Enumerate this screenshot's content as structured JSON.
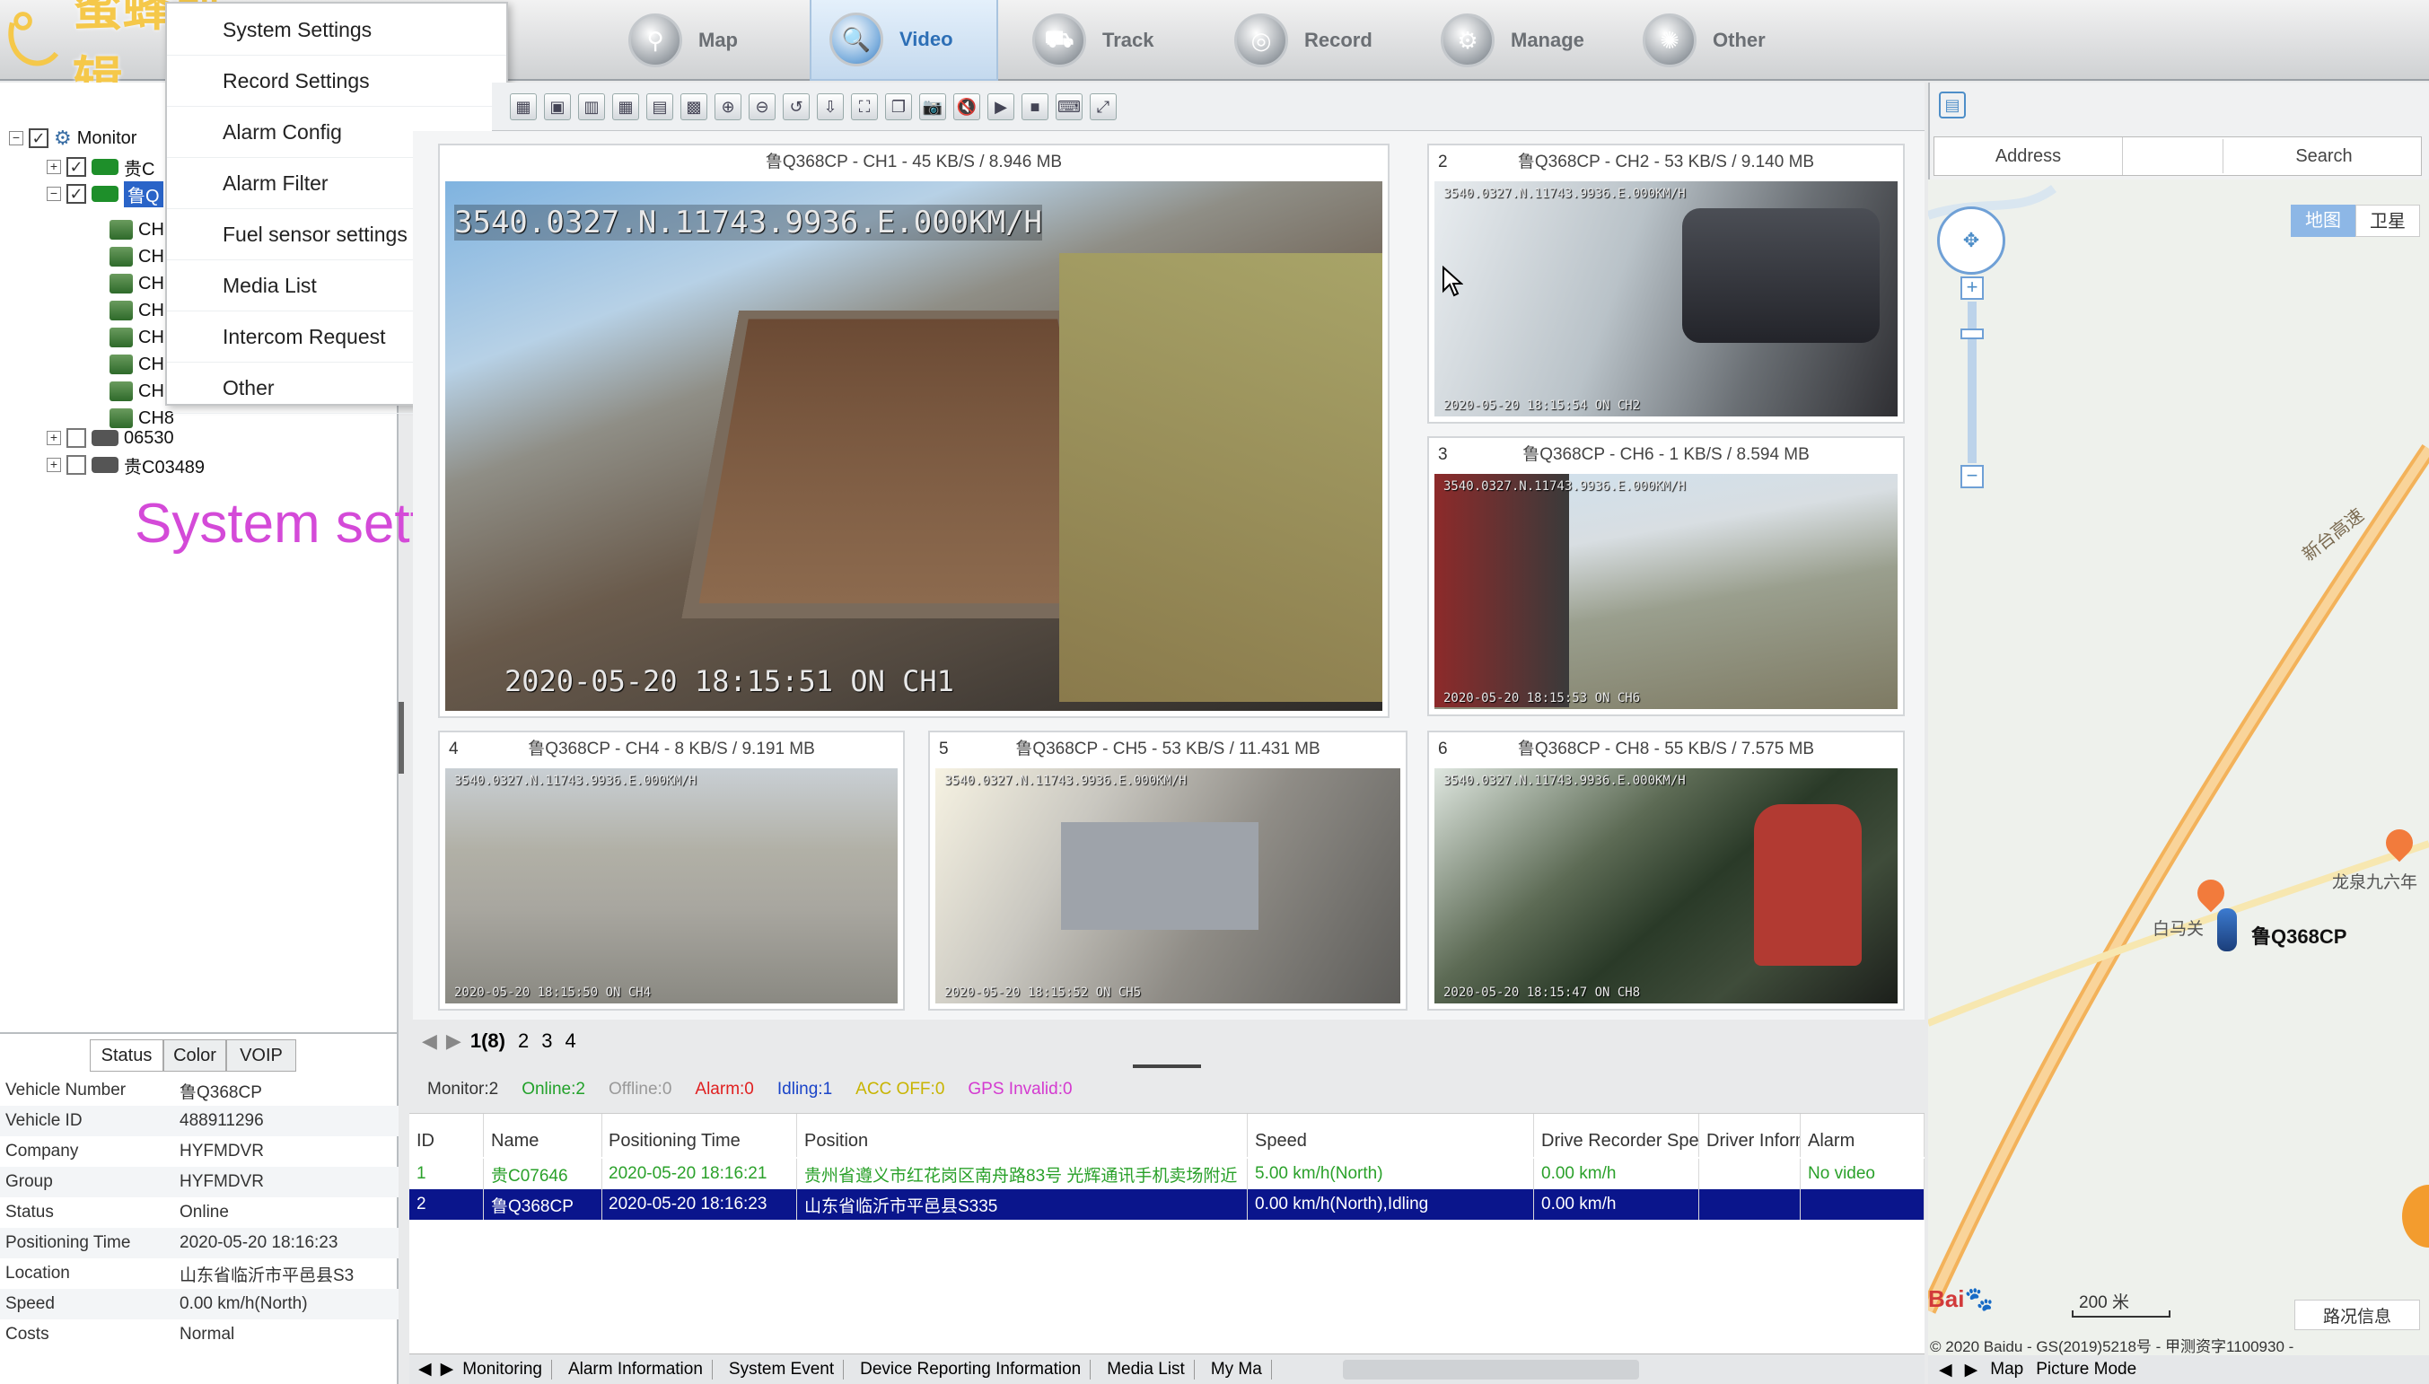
{
  "app": {
    "watermark": "蜜蜂剪辑"
  },
  "nav": {
    "items": [
      {
        "label": "Map",
        "icon": "map-icon"
      },
      {
        "label": "Video",
        "icon": "video-search-icon",
        "active": true
      },
      {
        "label": "Track",
        "icon": "track-icon"
      },
      {
        "label": "Record",
        "icon": "record-icon"
      },
      {
        "label": "Manage",
        "icon": "manage-icon"
      },
      {
        "label": "Other",
        "icon": "other-icon"
      }
    ]
  },
  "menu": {
    "items": [
      "System Settings",
      "Record Settings",
      "Alarm Config",
      "Alarm Filter",
      "Fuel sensor settings",
      "Media List",
      "Intercom Request",
      "Other"
    ]
  },
  "tree": {
    "root": "Monitor",
    "vehicles": [
      "贵C",
      "鲁Q",
      "06530",
      "贵C03489"
    ],
    "channels": [
      "CH",
      "CH",
      "CH",
      "CH",
      "CH",
      "CH",
      "CH",
      "CH8"
    ]
  },
  "overlay": {
    "system_setting": "System setting"
  },
  "status": {
    "tabs": [
      "Status",
      "Color",
      "VOIP"
    ],
    "rows": [
      {
        "k": "Vehicle Number",
        "v": "鲁Q368CP"
      },
      {
        "k": "Vehicle ID",
        "v": "488911296"
      },
      {
        "k": "Company",
        "v": "HYFMDVR"
      },
      {
        "k": "Group",
        "v": "HYFMDVR"
      },
      {
        "k": "Status",
        "v": "Online"
      },
      {
        "k": "Positioning Time",
        "v": "2020-05-20 18:16:23"
      },
      {
        "k": "Location",
        "v": "山东省临沂市平邑县S3"
      },
      {
        "k": "Speed",
        "v": "0.00 km/h(North)"
      },
      {
        "k": "Costs",
        "v": "Normal"
      }
    ]
  },
  "videos": [
    {
      "num": "",
      "title": "鲁Q368CP - CH1 - 45 KB/S / 8.946 MB",
      "osd_top": "3540.0327.N.11743.9936.E.000KM/H",
      "osd_bottom": "2020-05-20 18:15:51 ON  CH1"
    },
    {
      "num": "2",
      "title": "鲁Q368CP - CH2 - 53 KB/S / 9.140 MB",
      "osd_top": "3540.0327.N.11743.9936.E.000KM/H",
      "osd_bottom": "2020-05-20 18:15:54 ON  CH2"
    },
    {
      "num": "3",
      "title": "鲁Q368CP - CH6 - 1 KB/S / 8.594 MB",
      "osd_top": "3540.0327.N.11743.9936.E.000KM/H",
      "osd_bottom": "2020-05-20 18:15:53 ON  CH6"
    },
    {
      "num": "4",
      "title": "鲁Q368CP - CH4 - 8 KB/S / 9.191 MB",
      "osd_top": "3540.0327.N.11743.9936.E.000KM/H",
      "osd_bottom": "2020-05-20 18:15:50 ON  CH4"
    },
    {
      "num": "5",
      "title": "鲁Q368CP - CH5 - 53 KB/S / 11.431 MB",
      "osd_top": "3540.0327.N.11743.9936.E.000KM/H",
      "osd_bottom": "2020-05-20 18:15:52 ON  CH5"
    },
    {
      "num": "6",
      "title": "鲁Q368CP - CH8 - 55 KB/S / 7.575 MB",
      "osd_top": "3540.0327.N.11743.9936.E.000KM/H",
      "osd_bottom": "2020-05-20 18:15:47 ON  CH8"
    }
  ],
  "pager": {
    "pages": [
      "1(8)",
      "2",
      "3",
      "4"
    ]
  },
  "counts": [
    {
      "label": "Monitor:2",
      "color": "#333333"
    },
    {
      "label": "Online:2",
      "color": "#22a12a"
    },
    {
      "label": "Offline:0",
      "color": "#999999"
    },
    {
      "label": "Alarm:0",
      "color": "#e02020"
    },
    {
      "label": "Idling:1",
      "color": "#1a44c8"
    },
    {
      "label": "ACC OFF:0",
      "color": "#c8b400"
    },
    {
      "label": "GPS Invalid:0",
      "color": "#d43ad0"
    }
  ],
  "table": {
    "headers": [
      "ID",
      "Name",
      "Positioning Time",
      "Position",
      "Speed",
      "Drive Recorder Speed",
      "Driver Inform",
      "Alarm"
    ],
    "rows": [
      [
        "1",
        "贵C07646",
        "2020-05-20 18:16:21",
        "贵州省遵义市红花岗区南舟路83号 光辉通讯手机卖场附近",
        "5.00 km/h(North)",
        "0.00 km/h",
        "",
        "No video"
      ],
      [
        "2",
        "鲁Q368CP",
        "2020-05-20 18:16:23",
        "山东省临沂市平邑县S335",
        "0.00 km/h(North),Idling",
        "0.00 km/h",
        "",
        ""
      ]
    ]
  },
  "bottom_tabs": [
    "Monitoring",
    "Alarm Information",
    "System Event",
    "Device Reporting Information",
    "Media List",
    "My Ma"
  ],
  "map": {
    "address_label": "Address",
    "search_label": "Search",
    "type_map": "地图",
    "type_sat": "卫星",
    "road1": "新台高速",
    "place1": "白马关",
    "place2": "龙泉九六年",
    "vehicle_label": "鲁Q368CP",
    "scale": "200 米",
    "traffic": "路况信息",
    "copyright": "© 2020 Baidu - GS(2019)5218号 - 甲测资字1100930 -",
    "tabs": [
      "Map",
      "Picture Mode"
    ]
  }
}
